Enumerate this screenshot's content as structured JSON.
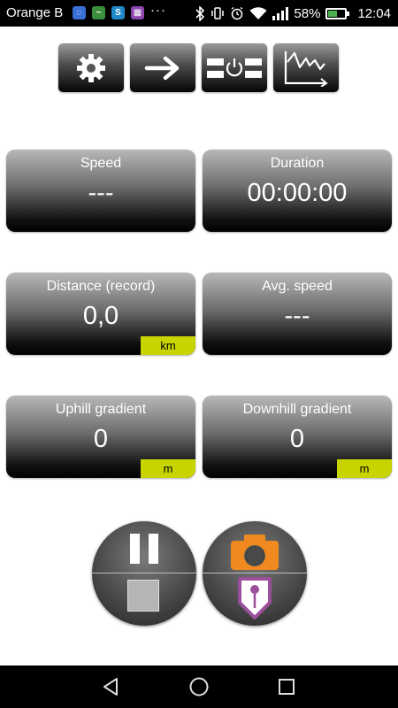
{
  "status_bar": {
    "carrier": "Orange B",
    "overflow": "···",
    "battery": "58%",
    "battery_level": 0.58,
    "time": "12:04",
    "notification_icons": [
      "shield-icon",
      "activity-icon",
      "s-app-icon",
      "puzzle-icon"
    ]
  },
  "toolbar": {
    "buttons": [
      "settings-icon",
      "arrow-right-icon",
      "power-switch-icon",
      "graph-icon"
    ]
  },
  "tiles": {
    "speed": {
      "label": "Speed",
      "value": "---"
    },
    "duration": {
      "label": "Duration",
      "value": "00:00:00"
    },
    "distance": {
      "label": "Distance (record)",
      "value": "0,0",
      "unit": "km"
    },
    "avg_speed": {
      "label": "Avg. speed",
      "value": "---"
    },
    "uphill": {
      "label": "Uphill gradient",
      "value": "0",
      "unit": "m"
    },
    "downhill": {
      "label": "Downhill gradient",
      "value": "0",
      "unit": "m"
    }
  },
  "controls": {
    "left": [
      "pause-icon",
      "stop-icon"
    ],
    "right": [
      "camera-icon",
      "waypoint-icon"
    ]
  },
  "colors": {
    "unit_badge": "#c8d400",
    "camera": "#f08a1e",
    "waypoint": "#9a4f9a",
    "battery": "#4caf50"
  },
  "nav": [
    "back-icon",
    "home-icon",
    "recents-icon"
  ]
}
